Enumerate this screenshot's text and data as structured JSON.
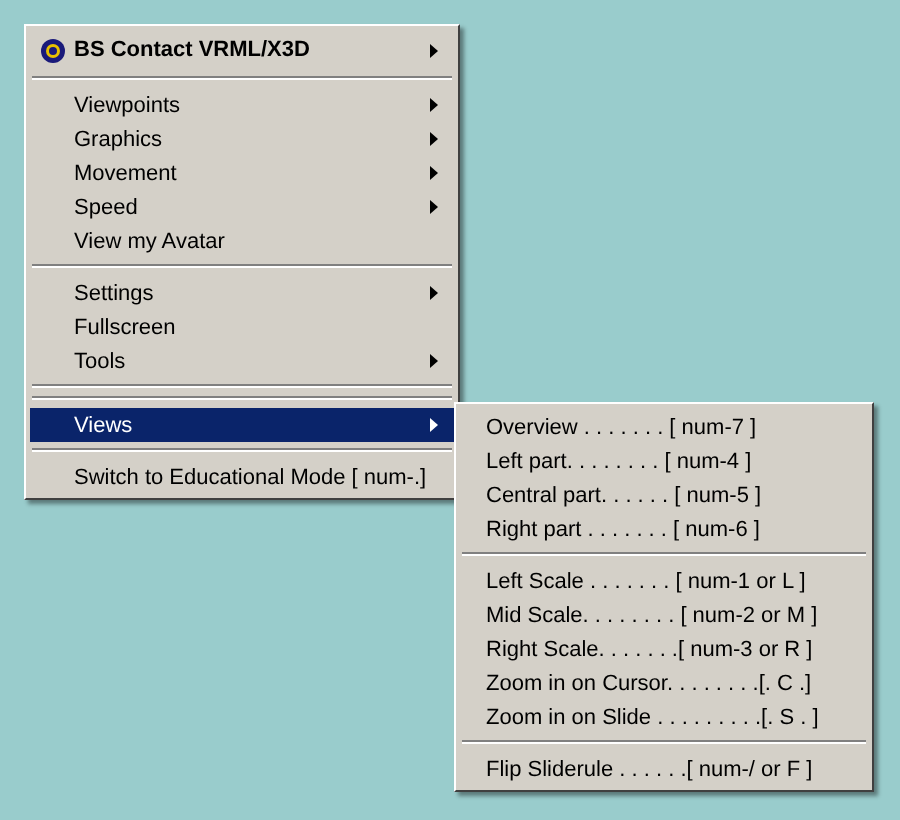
{
  "menu": {
    "items": [
      {
        "kind": "header",
        "label": "BS Contact VRML/X3D",
        "has_submenu": true,
        "selected": false
      },
      {
        "kind": "separator"
      },
      {
        "kind": "item",
        "label": "Viewpoints",
        "has_submenu": true,
        "selected": false
      },
      {
        "kind": "item",
        "label": "Graphics",
        "has_submenu": true,
        "selected": false
      },
      {
        "kind": "item",
        "label": "Movement",
        "has_submenu": true,
        "selected": false
      },
      {
        "kind": "item",
        "label": "Speed",
        "has_submenu": true,
        "selected": false
      },
      {
        "kind": "item",
        "label": "View my Avatar",
        "has_submenu": false,
        "selected": false
      },
      {
        "kind": "separator"
      },
      {
        "kind": "item",
        "label": "Settings",
        "has_submenu": true,
        "selected": false
      },
      {
        "kind": "item",
        "label": "Fullscreen",
        "has_submenu": false,
        "selected": false
      },
      {
        "kind": "item",
        "label": "Tools",
        "has_submenu": true,
        "selected": false
      },
      {
        "kind": "separator"
      },
      {
        "kind": "separator"
      },
      {
        "kind": "item",
        "label": "Views",
        "has_submenu": true,
        "selected": true
      },
      {
        "kind": "separator"
      },
      {
        "kind": "item",
        "label": "Switch to Educational Mode [ num-.]",
        "has_submenu": false,
        "selected": false
      }
    ]
  },
  "submenu": {
    "items": [
      {
        "kind": "item",
        "label": "Overview . . . . . . . [ num-7 ]"
      },
      {
        "kind": "item",
        "label": "Left part. . . . . . . . [ num-4 ]"
      },
      {
        "kind": "item",
        "label": "Central part. . . . . . [ num-5 ]"
      },
      {
        "kind": "item",
        "label": "Right part . . . . . . . [ num-6 ]"
      },
      {
        "kind": "separator"
      },
      {
        "kind": "item",
        "label": "Left Scale . . . . . . . [ num-1 or L ]"
      },
      {
        "kind": "item",
        "label": "Mid Scale. . . . . . . . [ num-2 or M ]"
      },
      {
        "kind": "item",
        "label": "Right Scale. . . . . . .[ num-3 or R ]"
      },
      {
        "kind": "item",
        "label": "Zoom in on Cursor. . . . . . . .[. C .]"
      },
      {
        "kind": "item",
        "label": "Zoom in on Slide . . . . . . . . .[. S . ]"
      },
      {
        "kind": "separator"
      },
      {
        "kind": "item",
        "label": "Flip Sliderule . . . . . .[ num-/ or F ]"
      }
    ]
  }
}
